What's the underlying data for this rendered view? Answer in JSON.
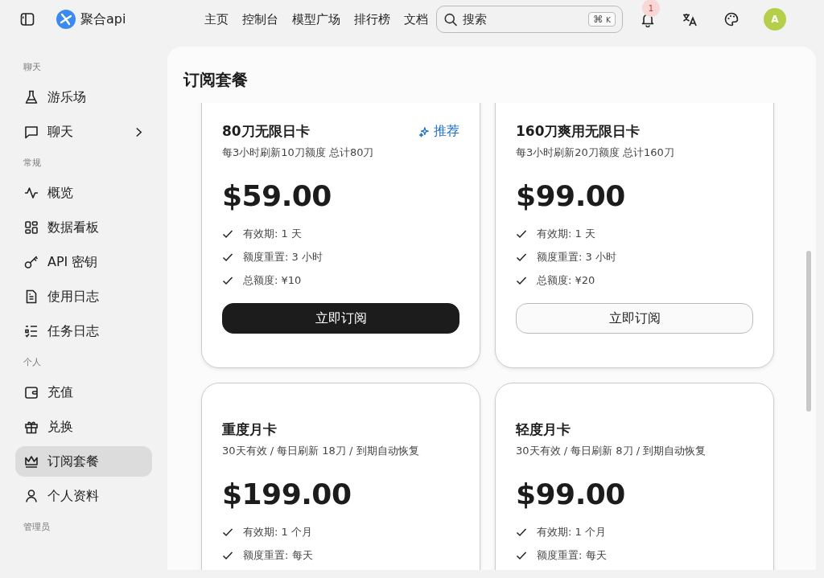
{
  "header": {
    "brand": "聚合api",
    "nav": [
      "主页",
      "控制台",
      "模型广场",
      "排行榜",
      "文档"
    ],
    "search": {
      "placeholder": "搜索",
      "shortcut": [
        "⌘",
        "K"
      ]
    },
    "notifications": {
      "count": "1"
    },
    "avatar": "A"
  },
  "sidebar": {
    "sections": [
      {
        "title": "聊天",
        "items": [
          {
            "label": "游乐场",
            "selected": false
          },
          {
            "label": "聊天",
            "selected": false,
            "expandable": true
          }
        ]
      },
      {
        "title": "常规",
        "items": [
          {
            "label": "概览",
            "selected": false
          },
          {
            "label": "数据看板",
            "selected": false
          },
          {
            "label": "API 密钥",
            "selected": false
          },
          {
            "label": "使用日志",
            "selected": false
          },
          {
            "label": "任务日志",
            "selected": false
          }
        ]
      },
      {
        "title": "个人",
        "items": [
          {
            "label": "充值",
            "selected": false
          },
          {
            "label": "兑换",
            "selected": false
          },
          {
            "label": "订阅套餐",
            "selected": true
          },
          {
            "label": "个人资料",
            "selected": false
          }
        ]
      },
      {
        "title": "管理员"
      }
    ]
  },
  "page": {
    "title": "订阅套餐",
    "plans": [
      {
        "name": "80刀无限日卡",
        "badge": "推荐",
        "description": "每3小时刷新10刀额度 总计80刀",
        "price": "$59.00",
        "features": [
          "有效期: 1 天",
          "额度重置: 3 小时",
          "总额度: ¥10"
        ],
        "button": {
          "label": "立即订阅",
          "primary": true
        }
      },
      {
        "name": "160刀爽用无限日卡",
        "description": "每3小时刷新20刀额度 总计160刀",
        "price": "$99.00",
        "features": [
          "有效期: 1 天",
          "额度重置: 3 小时",
          "总额度: ¥20"
        ],
        "button": {
          "label": "立即订阅",
          "primary": false
        }
      },
      {
        "name": "重度月卡",
        "description": "30天有效 / 每日刷新 18刀 / 到期自动恢复",
        "price": "$199.00",
        "features": [
          "有效期: 1 个月",
          "额度重置: 每天"
        ]
      },
      {
        "name": "轻度月卡",
        "description": "30天有效 / 每日刷新 8刀 / 到期自动恢复",
        "price": "$99.00",
        "features": [
          "有效期: 1 个月",
          "额度重置: 每天"
        ]
      }
    ]
  }
}
